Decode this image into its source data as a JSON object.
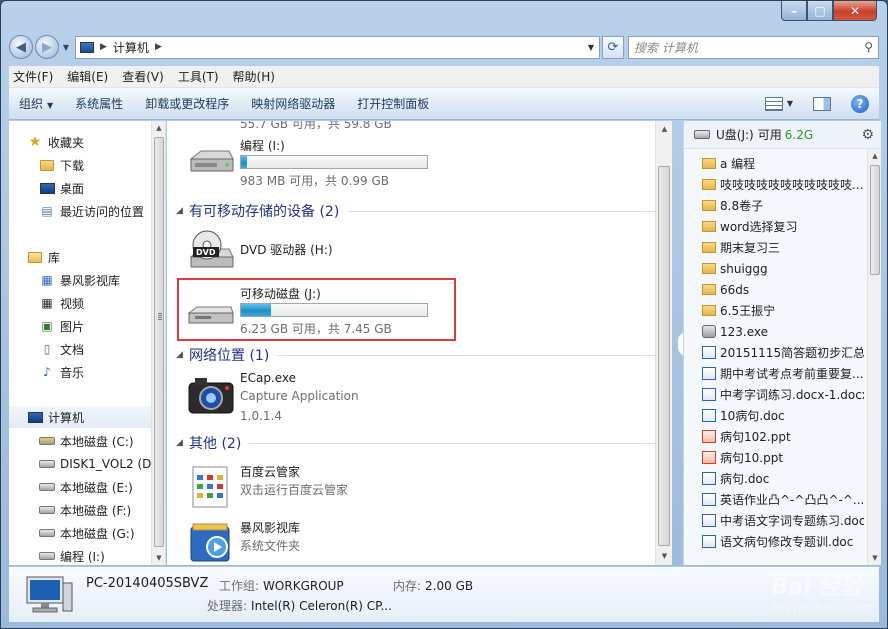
{
  "address": {
    "crumbs": [
      "计算机"
    ],
    "search_placeholder": "搜索 计算机"
  },
  "menu": [
    "文件(F)",
    "编辑(E)",
    "查看(V)",
    "工具(T)",
    "帮助(H)"
  ],
  "commands": {
    "organize": "组织",
    "system_props": "系统属性",
    "uninstall": "卸载或更改程序",
    "map_drive": "映射网络驱动器",
    "control_panel": "打开控制面板"
  },
  "nav": {
    "favorites": "收藏夹",
    "downloads": "下载",
    "desktop": "桌面",
    "recent": "最近访问的位置",
    "libraries": "库",
    "baofeng": "暴风影视库",
    "videos": "视频",
    "pictures": "图片",
    "documents": "文档",
    "music": "音乐",
    "computer": "计算机",
    "drive_c": "本地磁盘 (C:)",
    "drive_d": "DISK1_VOL2 (D",
    "drive_e": "本地磁盘 (E:)",
    "drive_f": "本地磁盘 (F:)",
    "drive_g": "本地磁盘 (G:)",
    "drive_i": "编程 (I:)"
  },
  "content": {
    "clipped_top": "55.7 GB 可用，共 59.8 GB",
    "drive_i_name": "编程 (I:)",
    "drive_i_free": "983 MB 可用，共 0.99 GB",
    "drive_i_used_fraction": 0.03,
    "removable_header": "有可移动存储的设备 (2)",
    "dvd_name": "DVD 驱动器 (H:)",
    "usb_name": "可移动磁盘 (J:)",
    "usb_free": "6.23 GB 可用，共 7.45 GB",
    "usb_used_fraction": 0.16,
    "network_header": "网络位置 (1)",
    "ecap_name": "ECap.exe",
    "ecap_desc": "Capture Application",
    "ecap_version": "1.0.1.4",
    "other_header": "其他 (2)",
    "baidu_name": "百度云管家",
    "baidu_desc": "双击运行百度云管家",
    "bf_name": "暴风影视库",
    "bf_desc": "系统文件夹"
  },
  "rpane": {
    "title": "U盘(J:)",
    "free_label": "可用",
    "free_value": "6.2G",
    "files": [
      {
        "name": "a 编程",
        "type": "fold"
      },
      {
        "name": "吱吱吱吱吱吱吱吱吱吱吱...",
        "type": "fold"
      },
      {
        "name": "8.8卷子",
        "type": "fold"
      },
      {
        "name": "word选择复习",
        "type": "fold"
      },
      {
        "name": "期末复习三",
        "type": "fold"
      },
      {
        "name": "shuiggg",
        "type": "fold"
      },
      {
        "name": "66ds",
        "type": "fold"
      },
      {
        "name": "6.5王振宁",
        "type": "fold"
      },
      {
        "name": "123.exe",
        "type": "exe"
      },
      {
        "name": "20151115简答题初步汇总...",
        "type": "doc"
      },
      {
        "name": "期中考试考点考前重要复...",
        "type": "doc"
      },
      {
        "name": "中考字词练习.docx-1.docx",
        "type": "doc"
      },
      {
        "name": "10病句.doc",
        "type": "doc"
      },
      {
        "name": "病句102.ppt",
        "type": "ppt"
      },
      {
        "name": "病句10.ppt",
        "type": "ppt"
      },
      {
        "name": "病句.doc",
        "type": "doc"
      },
      {
        "name": "英语作业凸^-^凸凸^-^...",
        "type": "doc"
      },
      {
        "name": "中考语文字词专题练习.doc",
        "type": "doc"
      },
      {
        "name": "语文病句修改专题训.doc",
        "type": "doc"
      }
    ]
  },
  "details": {
    "pc_name": "PC-20140405SBVZ",
    "workgroup_label": "工作组:",
    "workgroup_value": "WORKGROUP",
    "memory_label": "内存:",
    "memory_value": "2.00 GB",
    "cpu_label": "处理器:",
    "cpu_value": "Intel(R) Celeron(R) CP..."
  },
  "watermark": {
    "brand": "Bai 经验",
    "url": "jingyan.baidu.com"
  }
}
